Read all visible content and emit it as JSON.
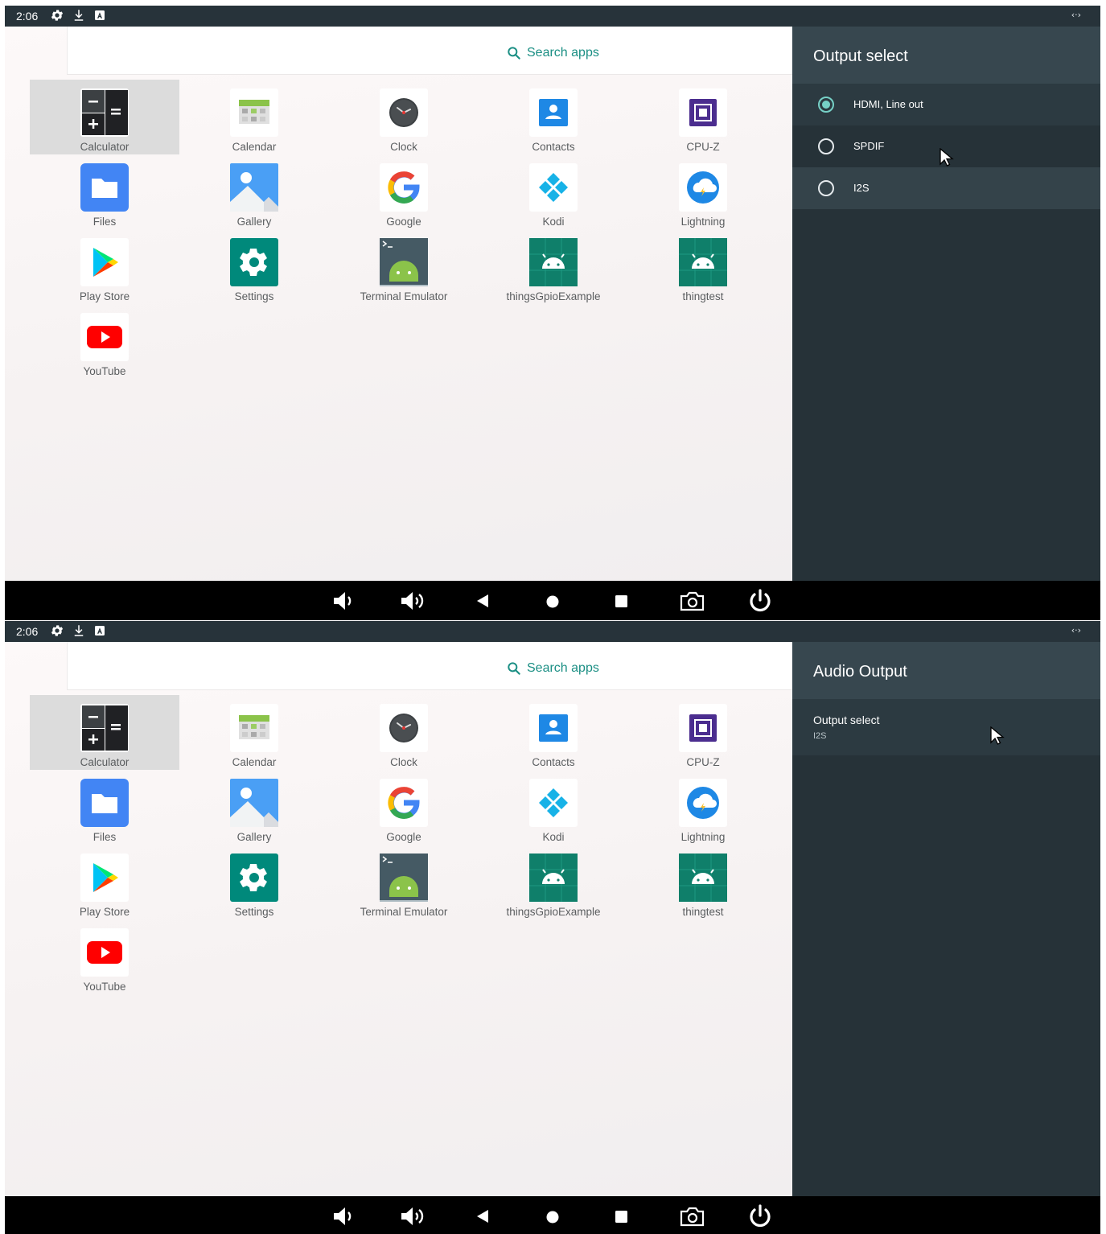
{
  "screens": [
    {
      "status": {
        "time": "2:06",
        "icons": [
          "settings-icon",
          "download-icon",
          "notification-a-icon"
        ],
        "right_icon": "cast-arrows-icon"
      },
      "search": {
        "label": "Search apps",
        "icon": "search-icon"
      },
      "apps": [
        {
          "label": "Calculator",
          "icon": "calculator-icon",
          "selected": true
        },
        {
          "label": "Calendar",
          "icon": "calendar-icon"
        },
        {
          "label": "Clock",
          "icon": "clock-icon"
        },
        {
          "label": "Contacts",
          "icon": "contacts-icon"
        },
        {
          "label": "CPU-Z",
          "icon": "cpu-z-icon"
        },
        {
          "label": "Files",
          "icon": "files-icon"
        },
        {
          "label": "Gallery",
          "icon": "gallery-icon"
        },
        {
          "label": "Google",
          "icon": "google-icon"
        },
        {
          "label": "Kodi",
          "icon": "kodi-icon"
        },
        {
          "label": "Lightning",
          "icon": "lightning-icon"
        },
        {
          "label": "Play Store",
          "icon": "play-store-icon"
        },
        {
          "label": "Settings",
          "icon": "settings-icon"
        },
        {
          "label": "Terminal Emulator",
          "icon": "terminal-emulator-icon"
        },
        {
          "label": "thingsGpioExample",
          "icon": "android-app-icon"
        },
        {
          "label": "thingtest",
          "icon": "android-app-icon"
        },
        {
          "label": "YouTube",
          "icon": "youtube-icon"
        }
      ],
      "panel": {
        "title": "Output select",
        "options": [
          {
            "label": "HDMI, Line out",
            "checked": true
          },
          {
            "label": "SPDIF",
            "checked": false
          },
          {
            "label": "I2S",
            "checked": false
          }
        ]
      }
    },
    {
      "status": {
        "time": "2:06",
        "icons": [
          "settings-icon",
          "download-icon",
          "notification-a-icon"
        ],
        "right_icon": "cast-arrows-icon"
      },
      "search": {
        "label": "Search apps",
        "icon": "search-icon"
      },
      "apps": [
        {
          "label": "Calculator",
          "icon": "calculator-icon",
          "selected": true
        },
        {
          "label": "Calendar",
          "icon": "calendar-icon"
        },
        {
          "label": "Clock",
          "icon": "clock-icon"
        },
        {
          "label": "Contacts",
          "icon": "contacts-icon"
        },
        {
          "label": "CPU-Z",
          "icon": "cpu-z-icon"
        },
        {
          "label": "Files",
          "icon": "files-icon"
        },
        {
          "label": "Gallery",
          "icon": "gallery-icon"
        },
        {
          "label": "Google",
          "icon": "google-icon"
        },
        {
          "label": "Kodi",
          "icon": "kodi-icon"
        },
        {
          "label": "Lightning",
          "icon": "lightning-icon"
        },
        {
          "label": "Play Store",
          "icon": "play-store-icon"
        },
        {
          "label": "Settings",
          "icon": "settings-icon"
        },
        {
          "label": "Terminal Emulator",
          "icon": "terminal-emulator-icon"
        },
        {
          "label": "thingsGpioExample",
          "icon": "android-app-icon"
        },
        {
          "label": "thingtest",
          "icon": "android-app-icon"
        },
        {
          "label": "YouTube",
          "icon": "youtube-icon"
        }
      ],
      "panel": {
        "title": "Audio Output",
        "preference": {
          "title": "Output select",
          "summary": "I2S"
        }
      }
    }
  ],
  "navbar": {
    "buttons": [
      "volume-down-icon",
      "volume-up-icon",
      "back-icon",
      "home-icon",
      "recents-icon",
      "screenshot-icon",
      "power-icon"
    ]
  },
  "colors": {
    "status_bar": "#27333a",
    "panel_bg": "#263238",
    "panel_header": "#37474f",
    "accent": "#76d0c6",
    "search_text": "#1b8f84",
    "navbar": "#000000"
  }
}
